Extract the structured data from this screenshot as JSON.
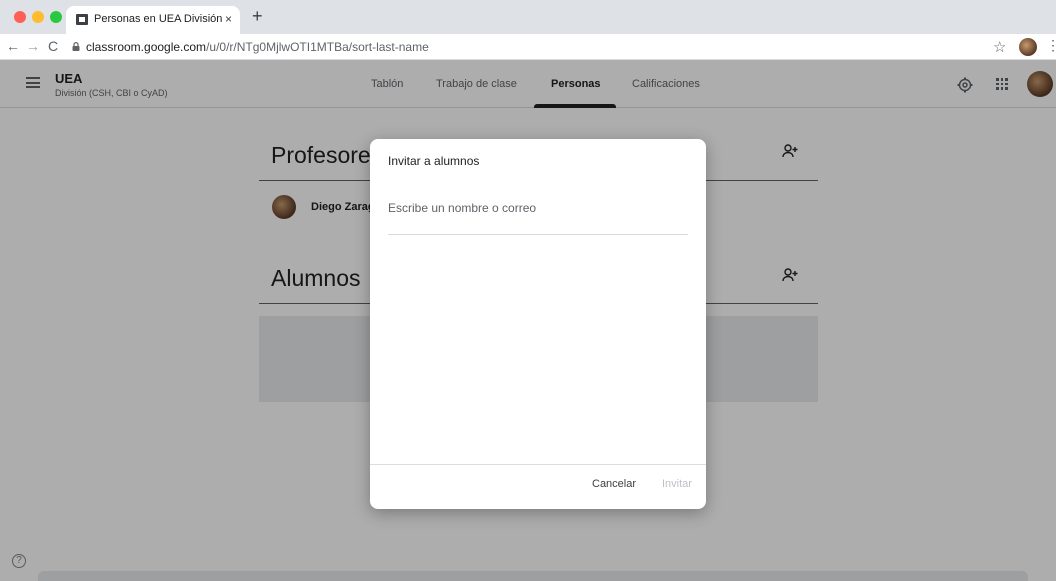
{
  "browser": {
    "tab_title": "Personas en UEA División (CSH",
    "tab_close": "×",
    "new_tab": "+",
    "back": "←",
    "forward": "→",
    "reload": "C",
    "url_host": "classroom.google.com",
    "url_path": "/u/0/r/NTg0MjlwOTI1MTBa/sort-last-name",
    "bookmark": "☆",
    "menu": "⋮"
  },
  "header": {
    "class_title": "UEA",
    "class_subtitle": "División (CSH, CBI o CyAD)",
    "tabs": [
      {
        "label": "Tablón"
      },
      {
        "label": "Trabajo de clase"
      },
      {
        "label": "Personas"
      },
      {
        "label": "Calificaciones"
      }
    ],
    "active_tab": "Personas"
  },
  "main": {
    "teachers_title": "Profesores",
    "teachers": [
      {
        "name": "Diego Zaragoza"
      }
    ],
    "students_title": "Alumnos",
    "help": "?"
  },
  "dialog": {
    "title": "Invitar a alumnos",
    "input_placeholder": "Escribe un nombre o correo",
    "input_value": "",
    "cancel_label": "Cancelar",
    "invite_label": "Invitar"
  },
  "colors": {
    "scrim": "#000000",
    "primary_text": "#202124",
    "secondary_text": "#5f6368",
    "disabled_text": "#bdc1c6"
  }
}
